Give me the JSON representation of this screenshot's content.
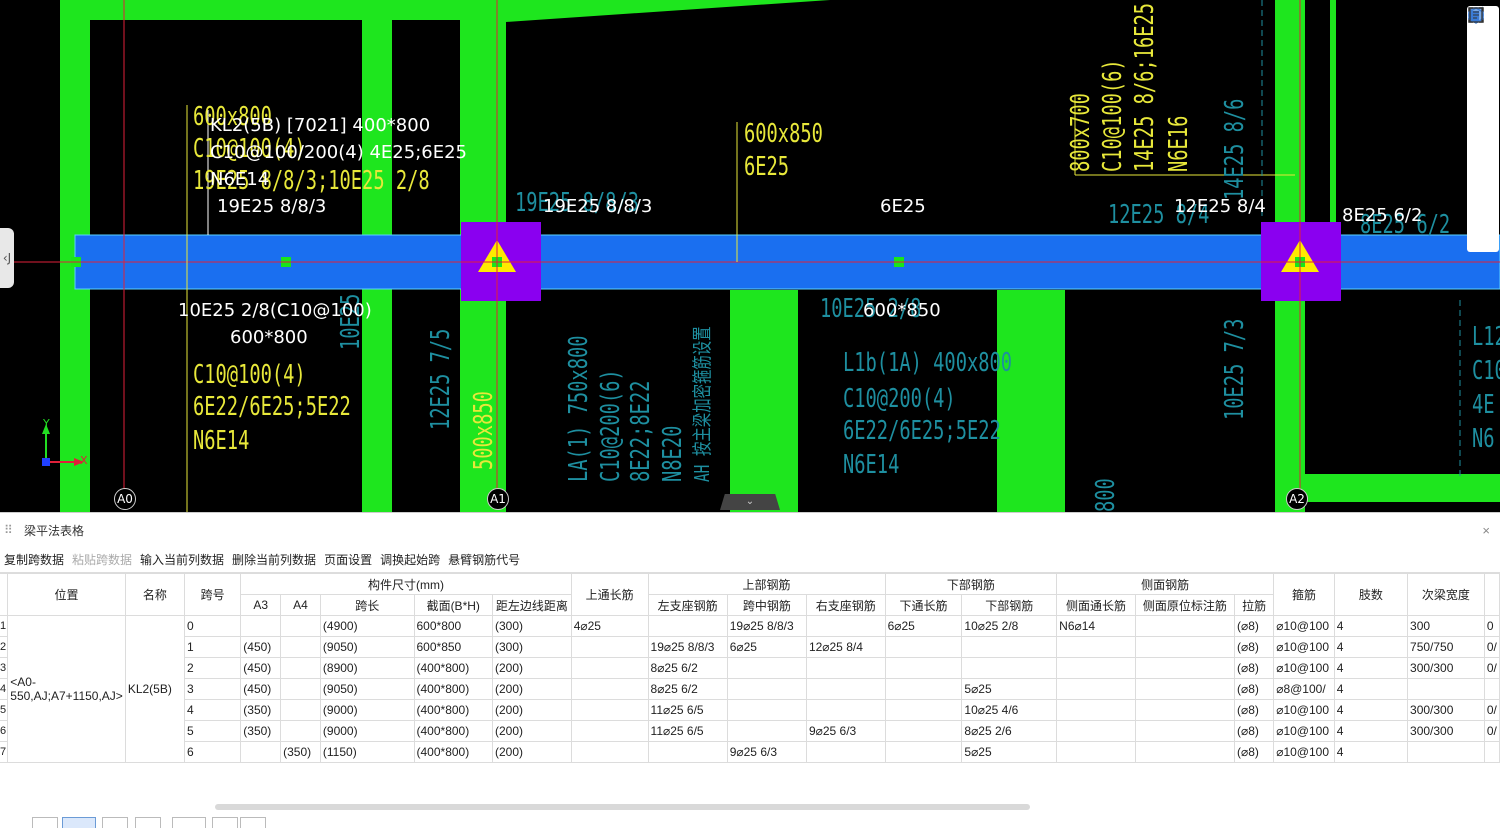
{
  "colors": {
    "beam_blue": "#1a6ff0",
    "column_purple": "#8a00f0",
    "wall_green": "#1ee61e",
    "text_yellow": "#e8e83a",
    "text_cyan": "#1e8fa0",
    "axis_red": "#e0203a"
  },
  "cad": {
    "beam_label": {
      "line1": "KL2(5B) [7021] 400*800",
      "line2": "C10@100/200(4) 4E25;6E25",
      "line3": "N6E14",
      "line4": "19E25 8/8/3"
    },
    "white_labels": {
      "a1_top": "19E25 8/8/3",
      "mid_top": "6E25",
      "a2_left": "12E25 8/4",
      "a2_right": "8E25 6/2",
      "bottom_left1": "10E25 2/8(C10@100)",
      "bottom_left2": "600*800",
      "bottom_mid": "600*850"
    },
    "yellow_labels": {
      "tl1": "600x800",
      "tl2": "C10@100(4)",
      "tl3": "19E25 8/8/3;10E25 2/8",
      "mid1": "600x850",
      "mid2": "6E25",
      "bl1": "C10@100(4)",
      "bl2": "6E22/6E25;5E22",
      "bl3": "N6E14",
      "vert_a1": "500x850",
      "tr1": "800x700",
      "tr2": "C10@100(6)",
      "tr3": "14E25 8/6;16E25",
      "tr4": "N6E16"
    },
    "cyan_labels": {
      "a1_top": "19E25 8/8/3",
      "a2_top": "12E25 8/4",
      "a2_right": "8E25 6/2",
      "mid_bottom": "10E25 2/8",
      "vert_left": "12E25 7/5",
      "vert_left2": "10E25",
      "vert_right": "10E25 7/3",
      "vert_right2": "14E25 8/6",
      "la1": "LA(1) 750x800",
      "la2": "C10@200(6)",
      "la3": "8E22;8E22",
      "la4": "N8E20",
      "la5": "AH 按主梁加密箍筋设置",
      "l1b1": "L1b(1A) 400x800",
      "l1b2": "C10@200(4)",
      "l1b3": "6E22/6E25;5E22",
      "l1b4": "N6E14",
      "right_r1": "L12",
      "right_r2": "C10",
      "right_r3": "4E",
      "right_r4": "N6",
      "bottom_vert": "800"
    },
    "axes": [
      "A0",
      "A1",
      "A2"
    ],
    "left_tab": "J",
    "ucs": {
      "x": "X",
      "y": "Y"
    }
  },
  "tools": [
    "sphere-icon",
    "3d-icon",
    "cube-outline-icon",
    "cube-solid-icon",
    "fullscreen-icon",
    "cube-view-icon",
    "notes-icon"
  ],
  "panel": {
    "title": "梁平法表格",
    "close": "×",
    "toolbar": [
      {
        "label": "复制跨数据",
        "enabled": true
      },
      {
        "label": "粘贴跨数据",
        "enabled": false
      },
      {
        "label": "输入当前列数据",
        "enabled": true
      },
      {
        "label": "删除当前列数据",
        "enabled": true
      },
      {
        "label": "页面设置",
        "enabled": true
      },
      {
        "label": "调换起始跨",
        "enabled": true
      },
      {
        "label": "悬臂钢筋代号",
        "enabled": true
      }
    ],
    "headers": {
      "position": "位置",
      "name": "名称",
      "span": "跨号",
      "size_group": "构件尺寸(mm)",
      "a3": "A3",
      "a4": "A4",
      "span_len": "跨长",
      "section": "截面(B*H)",
      "offset": "距左边线距离",
      "top_through": "上通长筋",
      "top_group": "上部钢筋",
      "left_support": "左支座钢筋",
      "mid_span": "跨中钢筋",
      "right_support": "右支座钢筋",
      "bottom_group": "下部钢筋",
      "bottom_through": "下通长筋",
      "bottom_bar": "下部钢筋",
      "side_group": "侧面钢筋",
      "side_through": "侧面通长筋",
      "side_mark": "侧面原位标注筋",
      "tie": "拉筋",
      "stirrup": "箍筋",
      "legs": "肢数",
      "sec_width": "次梁宽度"
    },
    "merged": {
      "position": "<A0-550,AJ;A7+1150,AJ>",
      "name": "KL2(5B)"
    },
    "rows": [
      {
        "n": "1",
        "span": "0",
        "a3": "",
        "a4": "",
        "len": "(4900)",
        "sec": "600*800",
        "off": "(300)",
        "top": "4⌀25",
        "left": "",
        "mid": "19⌀25 8/8/3",
        "right": "",
        "bthru": "6⌀25",
        "bot": "10⌀25 2/8",
        "sthru": "N6⌀14",
        "smark": "",
        "tie": "(⌀8)",
        "stir": "⌀10@100",
        "legs": "4",
        "sw": "300",
        "ex": "0"
      },
      {
        "n": "2",
        "span": "1",
        "a3": "(450)",
        "a4": "",
        "len": "(9050)",
        "sec": "600*850",
        "off": "(300)",
        "top": "",
        "left": "19⌀25 8/8/3",
        "mid": "6⌀25",
        "right": "12⌀25 8/4",
        "bthru": "",
        "bot": "",
        "sthru": "",
        "smark": "",
        "tie": "(⌀8)",
        "stir": "⌀10@100",
        "legs": "4",
        "sw": "750/750",
        "ex": "0/"
      },
      {
        "n": "3",
        "span": "2",
        "a3": "(450)",
        "a4": "",
        "len": "(8900)",
        "sec": "(400*800)",
        "off": "(200)",
        "top": "",
        "left": "8⌀25 6/2",
        "mid": "",
        "right": "",
        "bthru": "",
        "bot": "",
        "sthru": "",
        "smark": "",
        "tie": "(⌀8)",
        "stir": "⌀10@100",
        "legs": "4",
        "sw": "300/300",
        "ex": "0/"
      },
      {
        "n": "4",
        "span": "3",
        "a3": "(450)",
        "a4": "",
        "len": "(9050)",
        "sec": "(400*800)",
        "off": "(200)",
        "top": "",
        "left": "8⌀25 6/2",
        "mid": "",
        "right": "",
        "bthru": "",
        "bot": "5⌀25",
        "sthru": "",
        "smark": "",
        "tie": "(⌀8)",
        "stir": "⌀8@100/",
        "legs": "4",
        "sw": "",
        "ex": ""
      },
      {
        "n": "5",
        "span": "4",
        "a3": "(350)",
        "a4": "",
        "len": "(9000)",
        "sec": "(400*800)",
        "off": "(200)",
        "top": "",
        "left": "11⌀25 6/5",
        "mid": "",
        "right": "",
        "bthru": "",
        "bot": "10⌀25 4/6",
        "sthru": "",
        "smark": "",
        "tie": "(⌀8)",
        "stir": "⌀10@100",
        "legs": "4",
        "sw": "300/300",
        "ex": "0/"
      },
      {
        "n": "6",
        "span": "5",
        "a3": "(350)",
        "a4": "",
        "len": "(9000)",
        "sec": "(400*800)",
        "off": "(200)",
        "top": "",
        "left": "11⌀25 6/5",
        "mid": "",
        "right": "9⌀25 6/3",
        "bthru": "",
        "bot": "8⌀25 2/6",
        "sthru": "",
        "smark": "",
        "tie": "(⌀8)",
        "stir": "⌀10@100",
        "legs": "4",
        "sw": "300/300",
        "ex": "0/"
      },
      {
        "n": "7",
        "span": "6",
        "a3": "",
        "a4": "(350)",
        "len": "(1150)",
        "sec": "(400*800)",
        "off": "(200)",
        "top": "",
        "left": "",
        "mid": "9⌀25 6/3",
        "right": "",
        "bthru": "",
        "bot": "5⌀25",
        "sthru": "",
        "smark": "",
        "tie": "(⌀8)",
        "stir": "⌀10@100",
        "legs": "4",
        "sw": "",
        "ex": ""
      }
    ]
  }
}
